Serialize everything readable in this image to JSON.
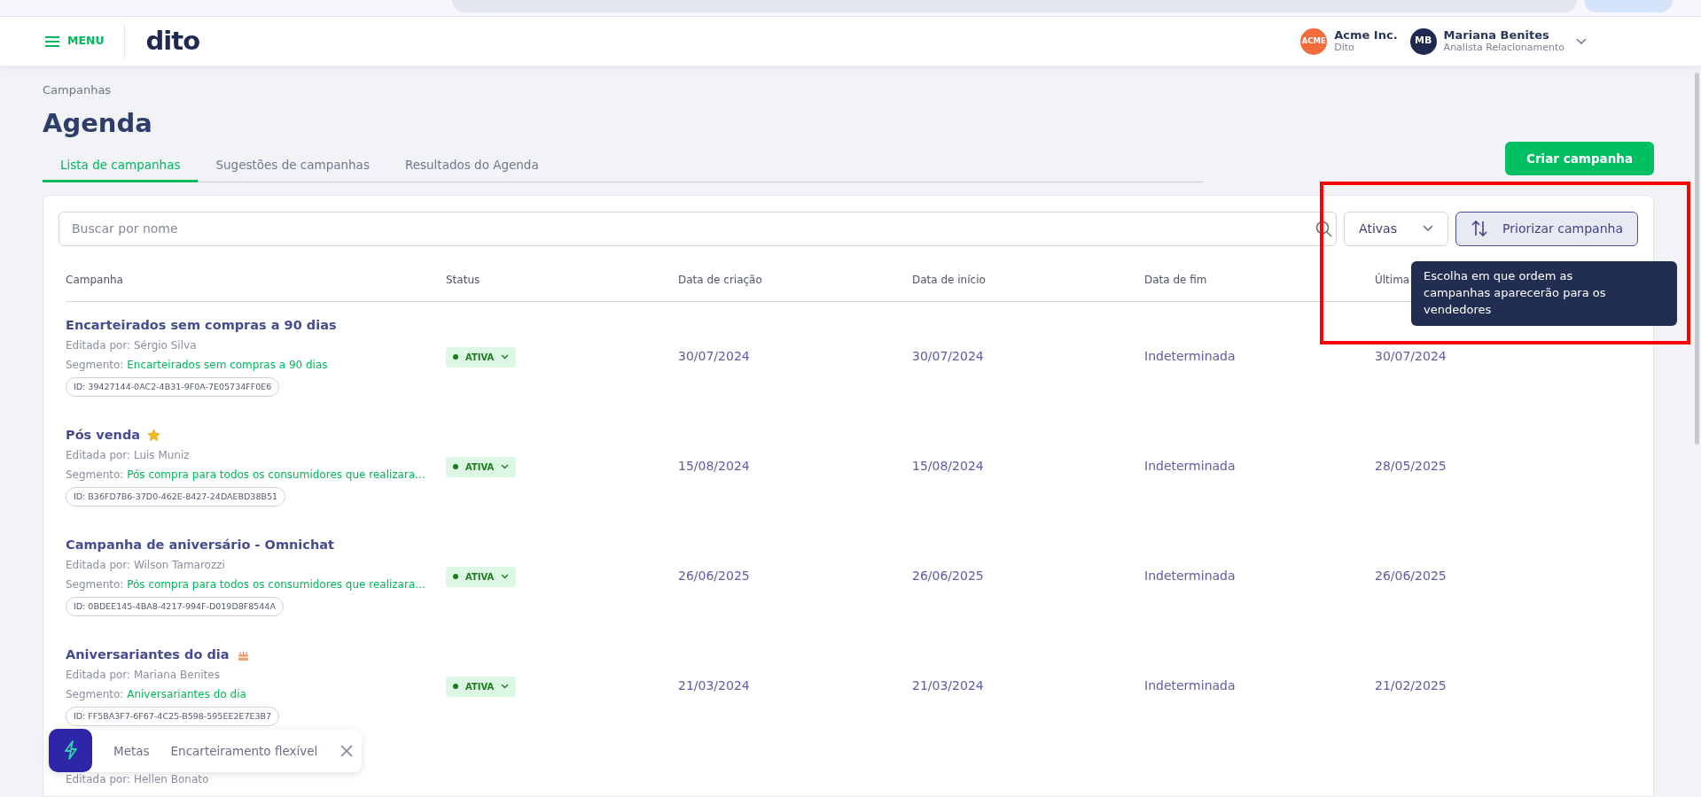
{
  "header": {
    "menu_label": "MENU",
    "logo": "dito",
    "account": {
      "avatar": "ACME",
      "name": "Acme Inc.",
      "subtitle": "Dito"
    },
    "user": {
      "avatar": "MB",
      "name": "Mariana Benites",
      "role": "Analista Relacionamento"
    }
  },
  "breadcrumb": "Campanhas",
  "title": "Agenda",
  "tabs": [
    {
      "label": "Lista de campanhas",
      "selected": true
    },
    {
      "label": "Sugestões de campanhas",
      "selected": false
    },
    {
      "label": "Resultados do Agenda",
      "selected": false
    }
  ],
  "primary_button": "Criar campanha",
  "search": {
    "placeholder": "Buscar por nome"
  },
  "filter": {
    "value": "Ativas"
  },
  "priority_button": "Priorizar campanha",
  "tooltip": "Escolha em que ordem as campanhas aparecerão para os vendedores",
  "table": {
    "columns": [
      "Campanha",
      "Status",
      "Data de criação",
      "Data de início",
      "Data de fim",
      "Última"
    ],
    "rows": [
      {
        "kind": "plain",
        "title": "Encarteirados sem compras a 90 dias",
        "editor": "Editada por: Sérgio Silva",
        "segment_label": "Segmento:",
        "segment": "Encarteirados sem compras a 90 dias",
        "id": "ID: 39427144-0AC2-4B31-9F0A-7E05734FF0E6",
        "status": "ATIVA",
        "created": "30/07/2024",
        "start": "30/07/2024",
        "end": "Indeterminada",
        "last": "30/07/2024"
      },
      {
        "kind": "star",
        "title": "Pós venda",
        "editor": "Editada por: Luis Muniz",
        "segment_label": "Segmento:",
        "segment": "Pós compra para todos os consumidores que realizara...",
        "id": "ID: B36FD7B6-37D0-462E-8427-24DAEBD38B51",
        "status": "ATIVA",
        "created": "15/08/2024",
        "start": "15/08/2024",
        "end": "Indeterminada",
        "last": "28/05/2025"
      },
      {
        "kind": "plain",
        "title": "Campanha de aniversário - Omnichat",
        "editor": "Editada por: Wilson Tamarozzi",
        "segment_label": "Segmento:",
        "segment": "Pós compra para todos os consumidores que realizara...",
        "id": "ID: 0BDEE145-4BA8-4217-994F-D019D8F8544A",
        "status": "ATIVA",
        "created": "26/06/2025",
        "start": "26/06/2025",
        "end": "Indeterminada",
        "last": "26/06/2025"
      },
      {
        "kind": "cake",
        "title": "Aniversariantes do dia",
        "editor": "Editada por: Mariana Benites",
        "segment_label": "Segmento:",
        "segment": "Aniversariantes do dia",
        "id": "ID: FF5BA3F7-6F67-4C25-B598-595EE2E7E3B7",
        "status": "ATIVA",
        "created": "21/03/2024",
        "start": "21/03/2024",
        "end": "Indeterminada",
        "last": "21/02/2025"
      },
      {
        "kind": "partial",
        "editor": "Editada por: Hellen Bonato"
      }
    ]
  },
  "widget": {
    "items": [
      "Metas",
      "Encarteiramento flexível"
    ]
  }
}
